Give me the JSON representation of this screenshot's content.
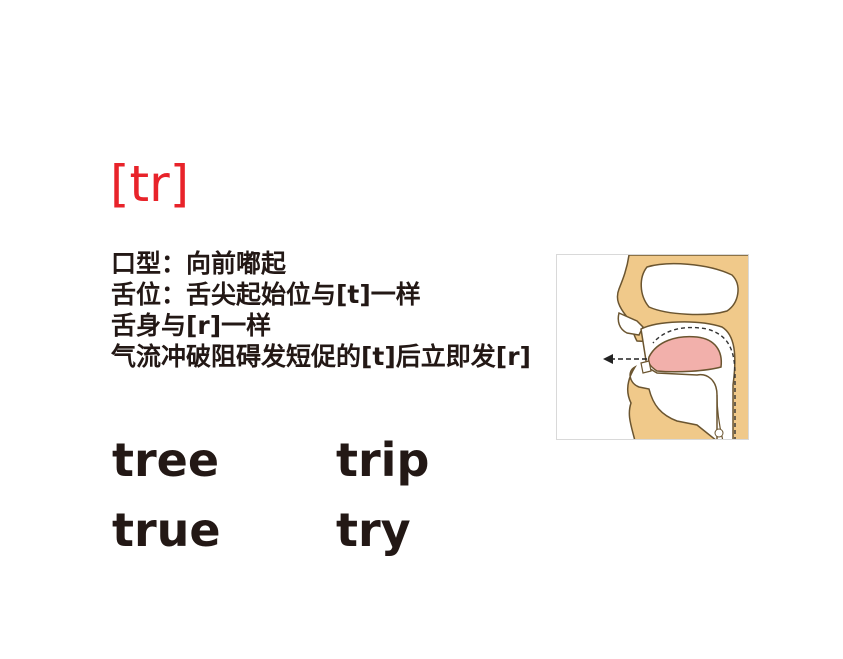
{
  "heading": {
    "phonetic": "[tr]",
    "color": "#e8232a"
  },
  "description": {
    "lines": [
      "口型：向前嘟起",
      "舌位：舌尖起始位与[t]一样",
      "舌身与[r]一样",
      "气流冲破阻碍发短促的[t]后立即发[r]"
    ]
  },
  "words": [
    "tree",
    "trip",
    "true",
    "try"
  ],
  "illustration": {
    "icon": "mouth-cross-section-icon"
  },
  "colors": {
    "text": "#231815",
    "accent": "#e8232a",
    "skin": "#f0c98a",
    "tongue": "#f2b0ab"
  }
}
